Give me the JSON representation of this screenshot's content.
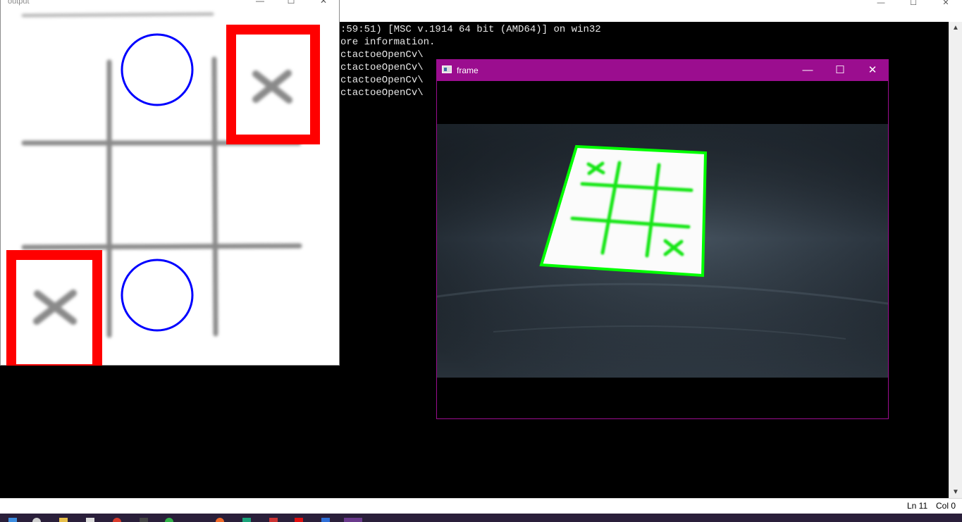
{
  "console": {
    "lines": [
      ":59:51) [MSC v.1914 64 bit (AMD64)] on win32",
      "ore information.",
      "",
      "ctactoeOpenCv\\",
      "",
      "ctactoeOpenCv\\",
      "",
      "ctactoeOpenCv\\",
      "",
      "ctactoeOpenCv\\"
    ]
  },
  "output_window": {
    "title": "output",
    "minimize": "—",
    "maximize": "☐",
    "close": "✕",
    "cells": [
      [
        "",
        "O",
        "X"
      ],
      [
        "",
        "",
        ""
      ],
      [
        "X",
        "O",
        ""
      ]
    ],
    "highlighted_cells": [
      "top-right",
      "bottom-left"
    ]
  },
  "frame_window": {
    "title": "frame",
    "minimize": "—",
    "maximize": "☐",
    "close": "✕"
  },
  "status": {
    "line": "Ln 11",
    "col": "Col 0"
  },
  "colors": {
    "frame_border": "#9b0d8f",
    "highlight": "#ff0000",
    "circle": "#0000ff",
    "contour": "#00ff00",
    "grid": "#8a8a8a"
  }
}
